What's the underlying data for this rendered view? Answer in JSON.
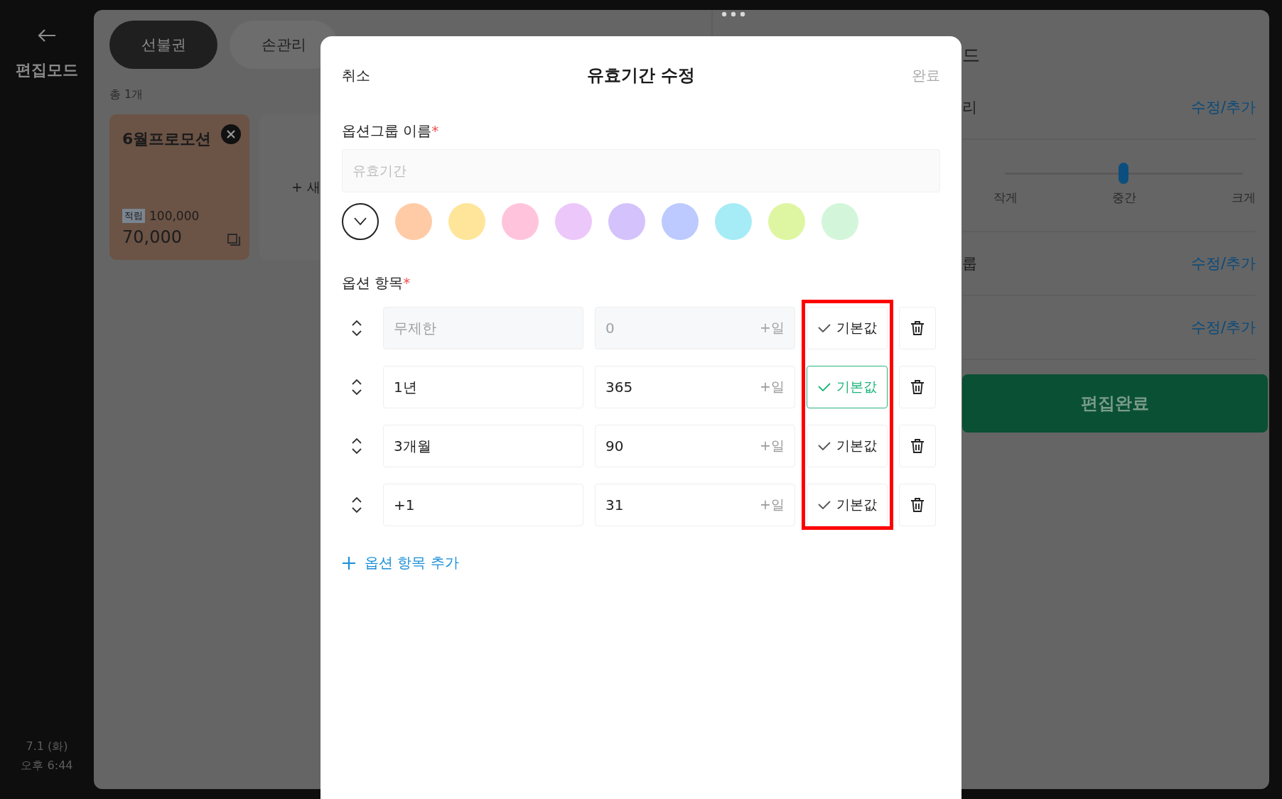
{
  "sidebar": {
    "title": "편집모드",
    "date": "7.1 (화)",
    "time": "오후 6:44"
  },
  "tabs": [
    {
      "label": "선불권",
      "selected": true
    },
    {
      "label": "손관리",
      "selected": false
    }
  ],
  "count": "총 1개",
  "cards": [
    {
      "title": "6월프로모션",
      "tag": "적립",
      "points": "100,000",
      "price": "70,000"
    }
  ],
  "new_card": "+ 새",
  "side_panel": {
    "title": "드",
    "rows": [
      {
        "kind": "link",
        "label": "리",
        "action": "수정/추가"
      },
      {
        "kind": "slider",
        "level": 0.5,
        "labels": [
          "작게",
          "중간",
          "크게"
        ]
      },
      {
        "kind": "link",
        "label": "룹",
        "action": "수정/추가"
      },
      {
        "kind": "link",
        "action": "수정/추가"
      }
    ],
    "done_button": "편집완료"
  },
  "modal": {
    "cancel": "취소",
    "title": "유효기간 수정",
    "done": {
      "label": "완료",
      "disabled": true
    },
    "name_label": "옵션그룹 이름",
    "name_required": "*",
    "name_field": {
      "placeholder": "유효기간"
    },
    "colors": [
      {
        "kind": "none",
        "selected": true
      },
      {
        "kind": "swatch",
        "color": "#ffcba6",
        "selected": false
      },
      {
        "kind": "swatch",
        "color": "#ffe59a",
        "selected": false
      },
      {
        "kind": "swatch",
        "color": "#ffc4dc",
        "selected": false
      },
      {
        "kind": "swatch",
        "color": "#ecc8fa",
        "selected": false
      },
      {
        "kind": "swatch",
        "color": "#d3c2fb",
        "selected": false
      },
      {
        "kind": "swatch",
        "color": "#bccaff",
        "selected": false
      },
      {
        "kind": "swatch",
        "color": "#a6ecf6",
        "selected": false
      },
      {
        "kind": "swatch",
        "color": "#def6a2",
        "selected": false
      },
      {
        "kind": "swatch",
        "color": "#d3f6da",
        "selected": false
      }
    ],
    "items_label": "옵션 항목",
    "items_required": "*",
    "items": [
      {
        "name": "무제한",
        "days": "0",
        "unit": "+일",
        "default_label": "기본값",
        "default": false,
        "disabled": true
      },
      {
        "name": "1년",
        "days": "365",
        "unit": "+일",
        "default_label": "기본값",
        "default": true,
        "disabled": false
      },
      {
        "name": "3개월",
        "days": "90",
        "unit": "+일",
        "default_label": "기본값",
        "default": false,
        "disabled": false
      },
      {
        "name": "+1",
        "days": "31",
        "unit": "+일",
        "default_label": "기본값",
        "default": false,
        "disabled": false
      }
    ],
    "add_item": "옵션 항목 추가"
  }
}
